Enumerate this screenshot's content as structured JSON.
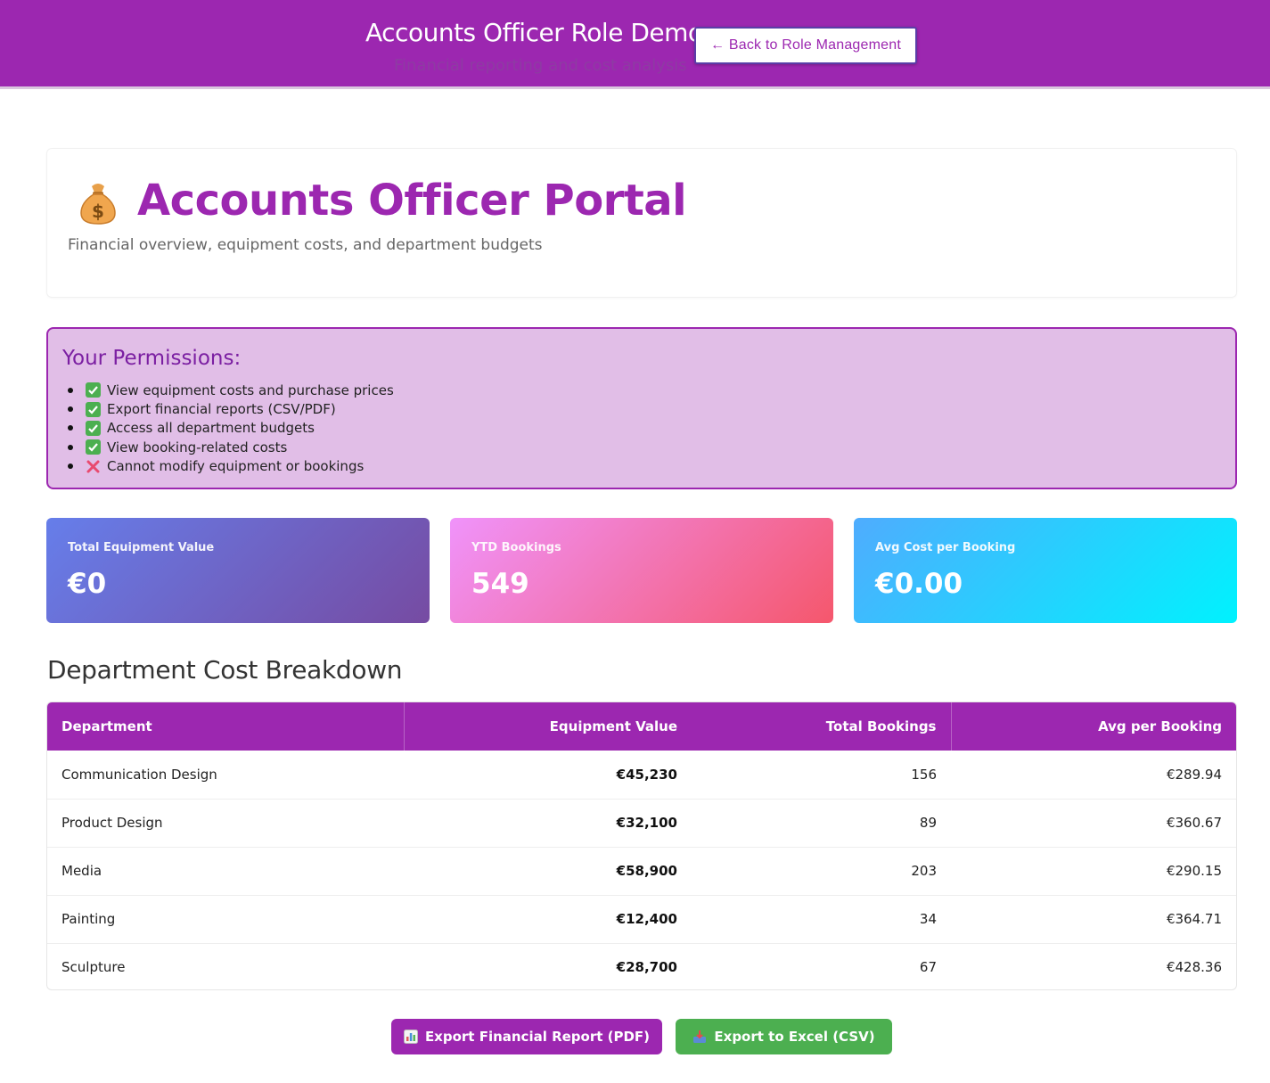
{
  "header": {
    "title": "Accounts Officer Role Demo",
    "subtitle": "Financial reporting and cost analysis",
    "back_button": "← Back to Role Management",
    "background": "#9c27b0"
  },
  "hero": {
    "icon": "money-bag-icon",
    "title": "Accounts Officer Portal",
    "subtitle": "Financial overview, equipment costs, and department budgets"
  },
  "permissions": {
    "title": "Your Permissions:",
    "items": [
      {
        "icon": "check-icon",
        "text": "View equipment costs and purchase prices"
      },
      {
        "icon": "check-icon",
        "text": "Export financial reports (CSV/PDF)"
      },
      {
        "icon": "check-icon",
        "text": "Access all department budgets"
      },
      {
        "icon": "check-icon",
        "text": "View booking-related costs"
      },
      {
        "icon": "cross-icon",
        "text": "Cannot modify equipment or bookings"
      }
    ]
  },
  "stats": [
    {
      "label": "Total Equipment Value",
      "value": "€0"
    },
    {
      "label": "YTD Bookings",
      "value": "549"
    },
    {
      "label": "Avg Cost per Booking",
      "value": "€0.00"
    }
  ],
  "breakdown": {
    "title": "Department Cost Breakdown",
    "columns": [
      "Department",
      "Equipment Value",
      "Total Bookings",
      "Avg per Booking"
    ],
    "rows": [
      {
        "department": "Communication Design",
        "equipment_value": "€45,230",
        "bookings": "156",
        "avg": "€289.94"
      },
      {
        "department": "Product Design",
        "equipment_value": "€32,100",
        "bookings": "89",
        "avg": "€360.67"
      },
      {
        "department": "Media",
        "equipment_value": "€58,900",
        "bookings": "203",
        "avg": "€290.15"
      },
      {
        "department": "Painting",
        "equipment_value": "€12,400",
        "bookings": "34",
        "avg": "€364.71"
      },
      {
        "department": "Sculpture",
        "equipment_value": "€28,700",
        "bookings": "67",
        "avg": "€428.36"
      }
    ]
  },
  "actions": {
    "pdf": {
      "label": "Export Financial Report (PDF)",
      "icon": "bar-chart-icon"
    },
    "csv": {
      "label": "Export to Excel (CSV)",
      "icon": "inbox-tray-icon"
    }
  },
  "colors": {
    "accent": "#9c27b0",
    "permissions_bg": "#e1bee7",
    "success": "#4caf50"
  }
}
